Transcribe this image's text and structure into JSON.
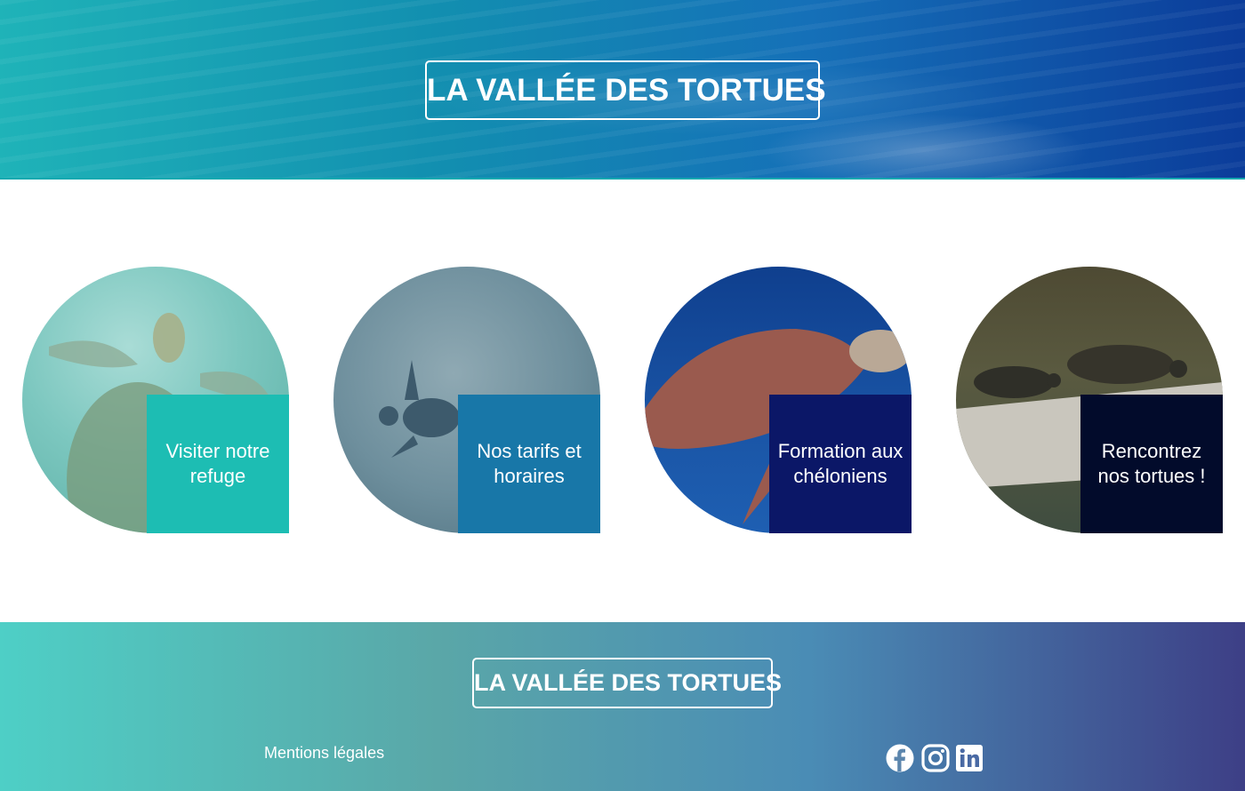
{
  "header": {
    "logo_text": "LA VALLÉE DES TORTUES"
  },
  "cards": [
    {
      "label": "Visiter notre refuge",
      "color": "#1dbdb3"
    },
    {
      "label": "Nos tarifs et horaires",
      "color": "#1877a8"
    },
    {
      "label": "Formation aux chéloniens",
      "color": "#0b1767"
    },
    {
      "label": "Rencontrez nos tortues !",
      "color": "#020b2b"
    }
  ],
  "footer": {
    "logo_text": "LA VALLÉE DES TORTUES",
    "legal_link": "Mentions légales",
    "social": [
      "facebook-icon",
      "instagram-icon",
      "linkedin-icon"
    ]
  }
}
